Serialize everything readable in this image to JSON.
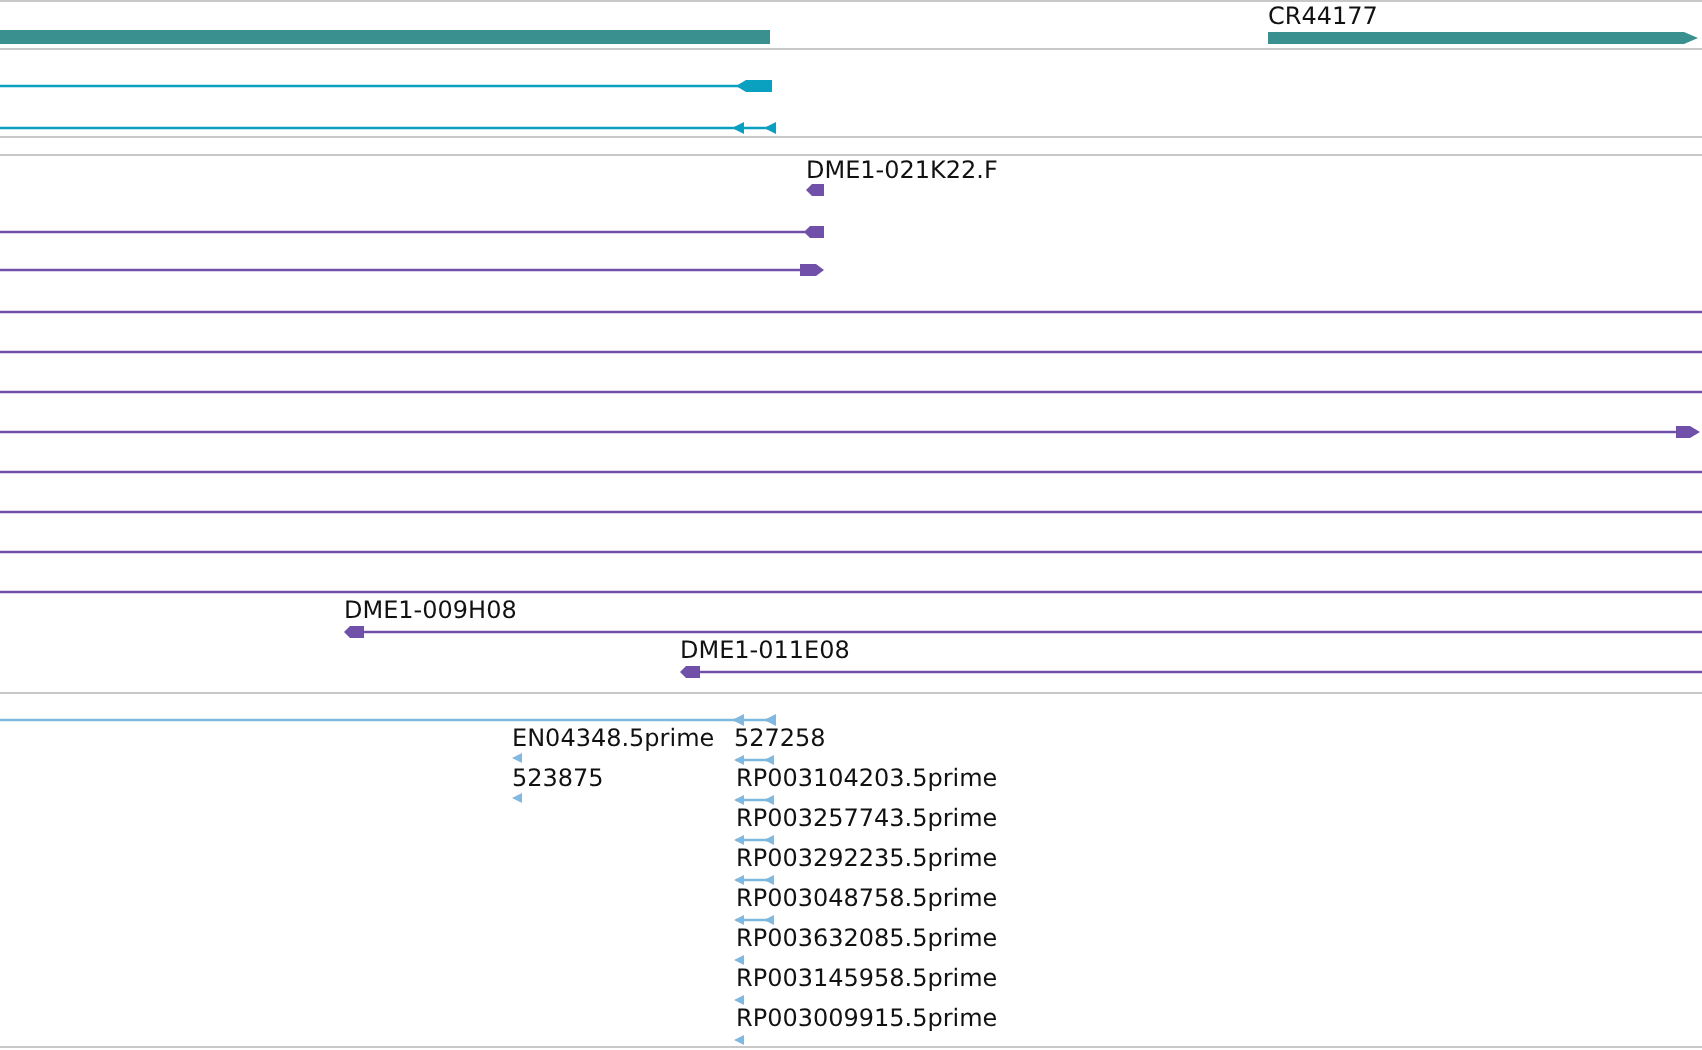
{
  "gene_track": {
    "labels": [
      "CR44177"
    ]
  },
  "clone_track": {
    "labels": [
      "DME1-021K22.F",
      "DME1-009H08",
      "DME1-011E08"
    ]
  },
  "est_track": {
    "labels": [
      "EN04348.5prime",
      "527258",
      "523875",
      "RP003104203.5prime",
      "RP003257743.5prime",
      "RP003292235.5prime",
      "RP003048758.5prime",
      "RP003632085.5prime",
      "RP003145958.5prime",
      "RP003009915.5prime"
    ]
  }
}
